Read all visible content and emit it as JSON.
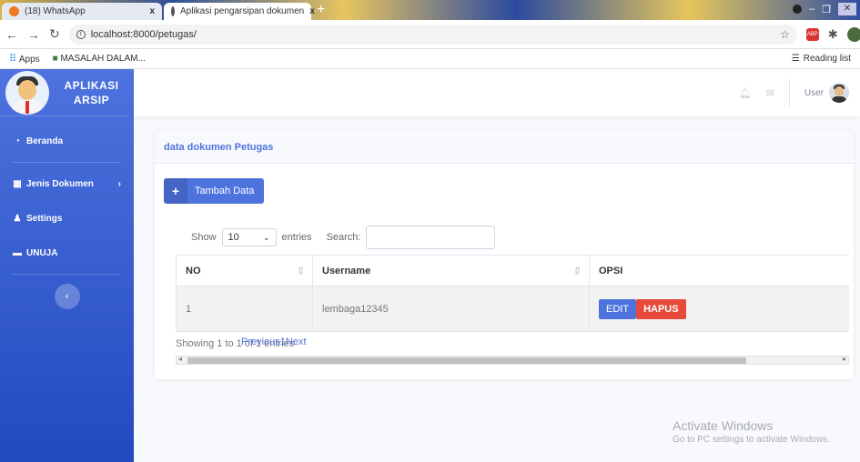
{
  "browser": {
    "tabs": [
      {
        "label": "(18) WhatsApp",
        "close": "x"
      },
      {
        "label": "Aplikasi pengarsipan dokumen",
        "close": "x"
      }
    ],
    "new_tab": "+",
    "url": "localhost:8000/petugas/",
    "bookmarks": [
      {
        "label": "Apps"
      },
      {
        "label": "MASALAH DALAM..."
      }
    ],
    "reading_list": "Reading list"
  },
  "sidebar": {
    "brand": "APLIKASI ARSIP",
    "items": [
      {
        "label": "Beranda"
      },
      {
        "label": "Jenis Dokumen"
      },
      {
        "label": "Settings"
      },
      {
        "label": "UNUJA"
      }
    ]
  },
  "topbar": {
    "user": "User"
  },
  "card": {
    "title": "data dokumen Petugas",
    "add_button": "Tambah Data",
    "show_label": "Show",
    "entries_value": "10",
    "entries_label": "entries",
    "search_label": "Search:",
    "columns": [
      "NO",
      "Username",
      "OPSI"
    ],
    "rows": [
      {
        "no": "1",
        "username": "lembaga12345",
        "edit": "EDIT",
        "delete": "HAPUS"
      }
    ],
    "info": "Showing 1 to 1 of 1 entries",
    "pager": "Previous1Next"
  },
  "watermark": {
    "line1": "Activate Windows",
    "line2": "Go to PC settings to activate Windows."
  }
}
